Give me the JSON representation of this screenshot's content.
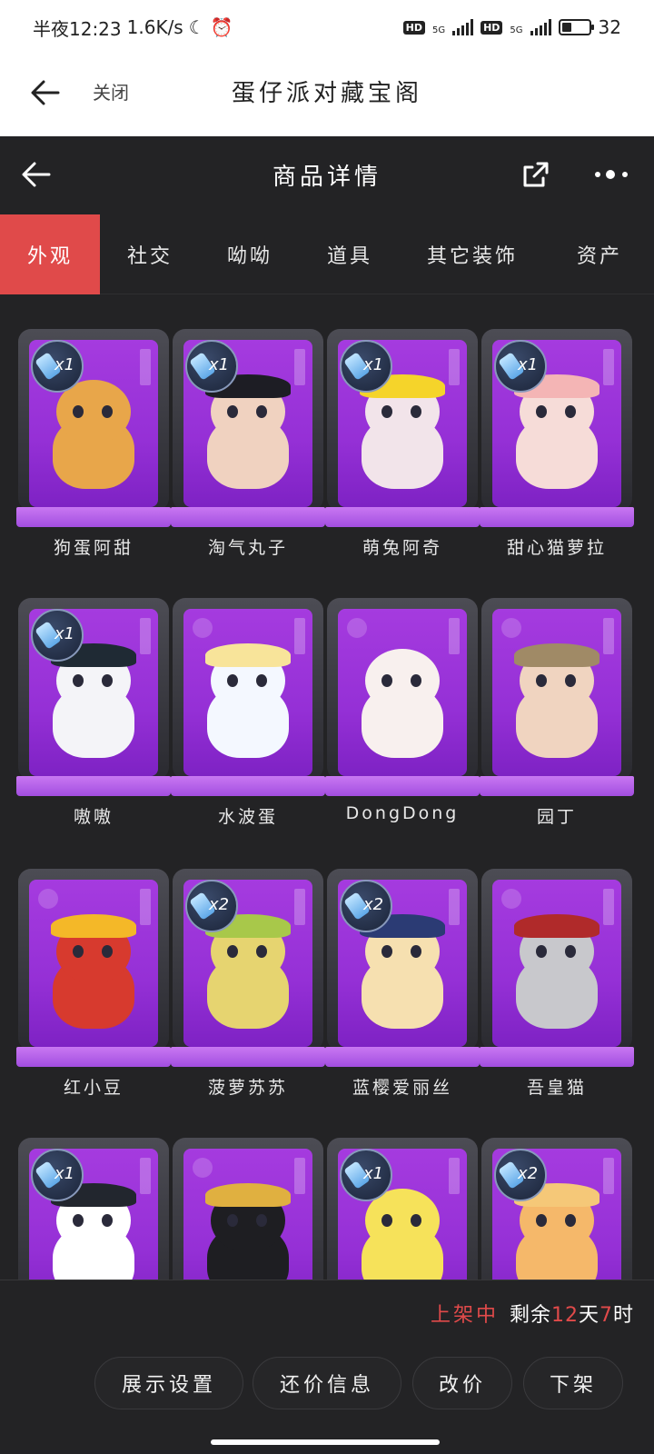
{
  "status_bar": {
    "time": "半夜12:23",
    "speed": "1.6K/s",
    "hd1": "HD",
    "net1": "5G",
    "hd2": "HD",
    "net2": "5G",
    "battery_level": "32",
    "battery_fill": 0.32
  },
  "web_bar": {
    "close_label": "关闭",
    "title": "蛋仔派对藏宝阁"
  },
  "header": {
    "title": "商品详情"
  },
  "tabs": [
    {
      "label": "外观",
      "active": true
    },
    {
      "label": "社交",
      "active": false
    },
    {
      "label": "呦呦",
      "active": false
    },
    {
      "label": "道具",
      "active": false
    },
    {
      "label": "其它装饰",
      "active": false
    },
    {
      "label": "资产",
      "active": false
    }
  ],
  "items": [
    {
      "name": "狗蛋阿甜",
      "badge": "x1",
      "color": "#e8a64a",
      "hat": ""
    },
    {
      "name": "淘气丸子",
      "badge": "x1",
      "color": "#f0d2c0",
      "hat": "#1d1d24"
    },
    {
      "name": "萌兔阿奇",
      "badge": "x1",
      "color": "#f2e4ea",
      "hat": "#f5d42a"
    },
    {
      "name": "甜心猫萝拉",
      "badge": "x1",
      "color": "#f6dcd8",
      "hat": "#f4b5b5"
    },
    {
      "name": "嗷嗷",
      "badge": "x1",
      "color": "#f4f4f8",
      "hat": "#1f2a34"
    },
    {
      "name": "水波蛋",
      "badge": "",
      "color": "#f4f8ff",
      "hat": "#f8e49a"
    },
    {
      "name": "DongDong",
      "badge": "",
      "color": "#f8f0ee",
      "hat": ""
    },
    {
      "name": "园丁",
      "badge": "",
      "color": "#f0d4c0",
      "hat": "#a08a66"
    },
    {
      "name": "红小豆",
      "badge": "",
      "color": "#d73a2e",
      "hat": "#f4b828"
    },
    {
      "name": "菠萝苏苏",
      "badge": "x2",
      "color": "#e6d470",
      "hat": "#a8c84a"
    },
    {
      "name": "蓝樱爱丽丝",
      "badge": "x2",
      "color": "#f6e0b0",
      "hat": "#2b3b74"
    },
    {
      "name": "吾皇猫",
      "badge": "",
      "color": "#c8c8cc",
      "hat": "#b02a2a"
    },
    {
      "name": "",
      "badge": "x1",
      "color": "#ffffff",
      "hat": "#22262e"
    },
    {
      "name": "",
      "badge": "",
      "color": "#1e1e22",
      "hat": "#e0b040"
    },
    {
      "name": "",
      "badge": "x1",
      "color": "#f6e25a",
      "hat": ""
    },
    {
      "name": "",
      "badge": "x2",
      "color": "#f5b86a",
      "hat": "#f5c878"
    }
  ],
  "listing": {
    "status": "上架中",
    "remain_prefix": "剩余",
    "days": "12",
    "day_unit": "天",
    "hours": "7",
    "hour_unit": "时"
  },
  "buttons": {
    "display_settings": "展示设置",
    "bargain_info": "还价信息",
    "change_price": "改价",
    "delist": "下架"
  }
}
